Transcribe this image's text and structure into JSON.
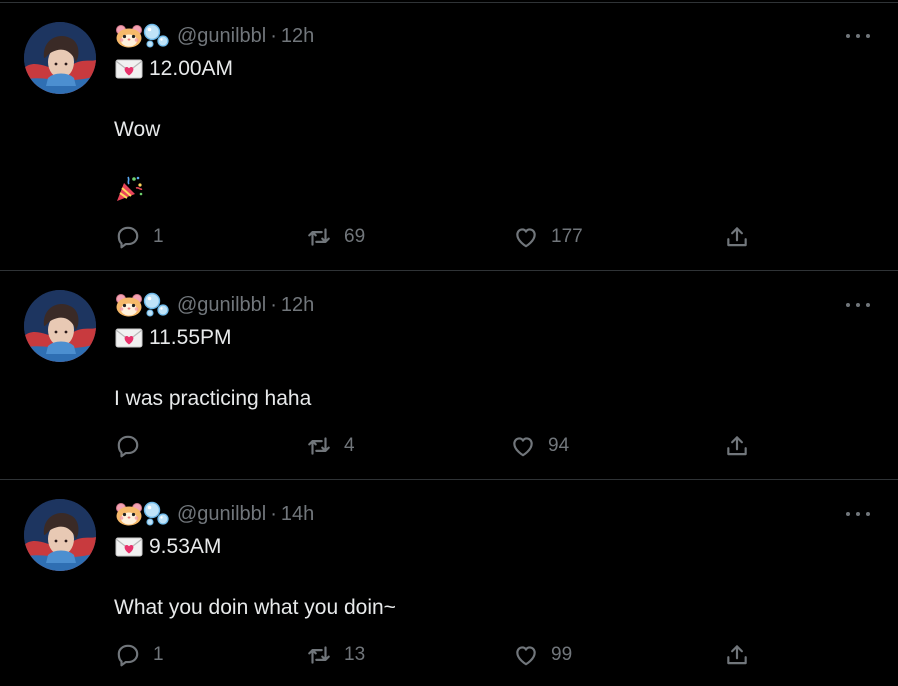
{
  "colors": {
    "background": "#000000",
    "text": "#e7e9ea",
    "muted": "#71767b",
    "divider": "#2f3336"
  },
  "tweets": [
    {
      "handle": "@gunilbbl",
      "time": "12h",
      "time_line": "12.00AM",
      "text": "Wow",
      "extra_emoji": "party-popper-icon",
      "replies": "1",
      "retweets": "69",
      "likes": "177"
    },
    {
      "handle": "@gunilbbl",
      "time": "12h",
      "time_line": "11.55PM",
      "text": "I was practicing haha",
      "replies": "",
      "retweets": "4",
      "likes": "94"
    },
    {
      "handle": "@gunilbbl",
      "time": "14h",
      "time_line": "9.53AM",
      "text": "What you doin what you doin~",
      "replies": "1",
      "retweets": "13",
      "likes": "99"
    }
  ],
  "separator": "·"
}
